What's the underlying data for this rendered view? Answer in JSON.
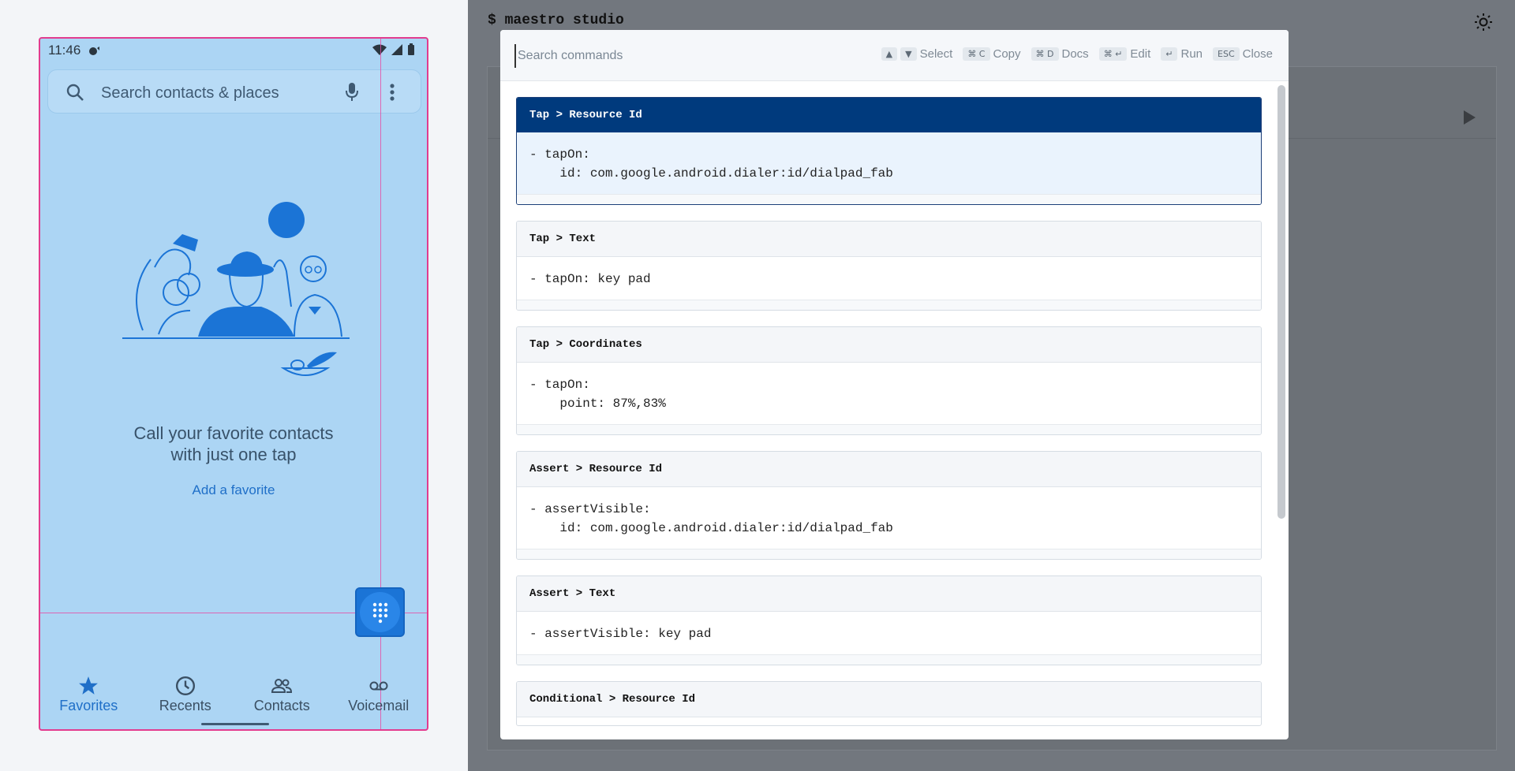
{
  "phone": {
    "time": "11:46",
    "search_placeholder": "Search contacts & places",
    "message_line1": "Call your favorite contacts",
    "message_line2": "with just one tap",
    "add_favorite": "Add a favorite",
    "nav": [
      {
        "label": "Favorites",
        "icon": "star-icon",
        "active": true
      },
      {
        "label": "Recents",
        "icon": "clock-icon",
        "active": false
      },
      {
        "label": "Contacts",
        "icon": "people-icon",
        "active": false
      },
      {
        "label": "Voicemail",
        "icon": "voicemail-icon",
        "active": false
      }
    ]
  },
  "studio": {
    "title": "$ maestro studio"
  },
  "command_palette": {
    "search_placeholder": "Search commands",
    "hints": [
      {
        "keys": [
          "▲",
          "▼"
        ],
        "label": "Select"
      },
      {
        "keys": [
          "⌘ C"
        ],
        "label": "Copy"
      },
      {
        "keys": [
          "⌘ D"
        ],
        "label": "Docs"
      },
      {
        "keys": [
          "⌘ ↵"
        ],
        "label": "Edit"
      },
      {
        "keys": [
          "↵"
        ],
        "label": "Run"
      },
      {
        "keys": [
          "ESC"
        ],
        "label": "Close"
      }
    ],
    "commands": [
      {
        "title": "Tap > Resource Id",
        "code": "- tapOn:\n    id: com.google.android.dialer:id/dialpad_fab",
        "selected": true
      },
      {
        "title": "Tap > Text",
        "code": "- tapOn: key pad",
        "selected": false
      },
      {
        "title": "Tap > Coordinates",
        "code": "- tapOn:\n    point: 87%,83%",
        "selected": false
      },
      {
        "title": "Assert > Resource Id",
        "code": "- assertVisible:\n    id: com.google.android.dialer:id/dialpad_fab",
        "selected": false
      },
      {
        "title": "Assert > Text",
        "code": "- assertVisible: key pad",
        "selected": false
      },
      {
        "title": "Conditional > Resource Id",
        "code": "",
        "selected": false
      }
    ]
  },
  "colors": {
    "selected_header": "#003a7d",
    "phone_overlay": "#acd5f4",
    "accent": "#1b74d6",
    "guide": "#e84aa2"
  }
}
